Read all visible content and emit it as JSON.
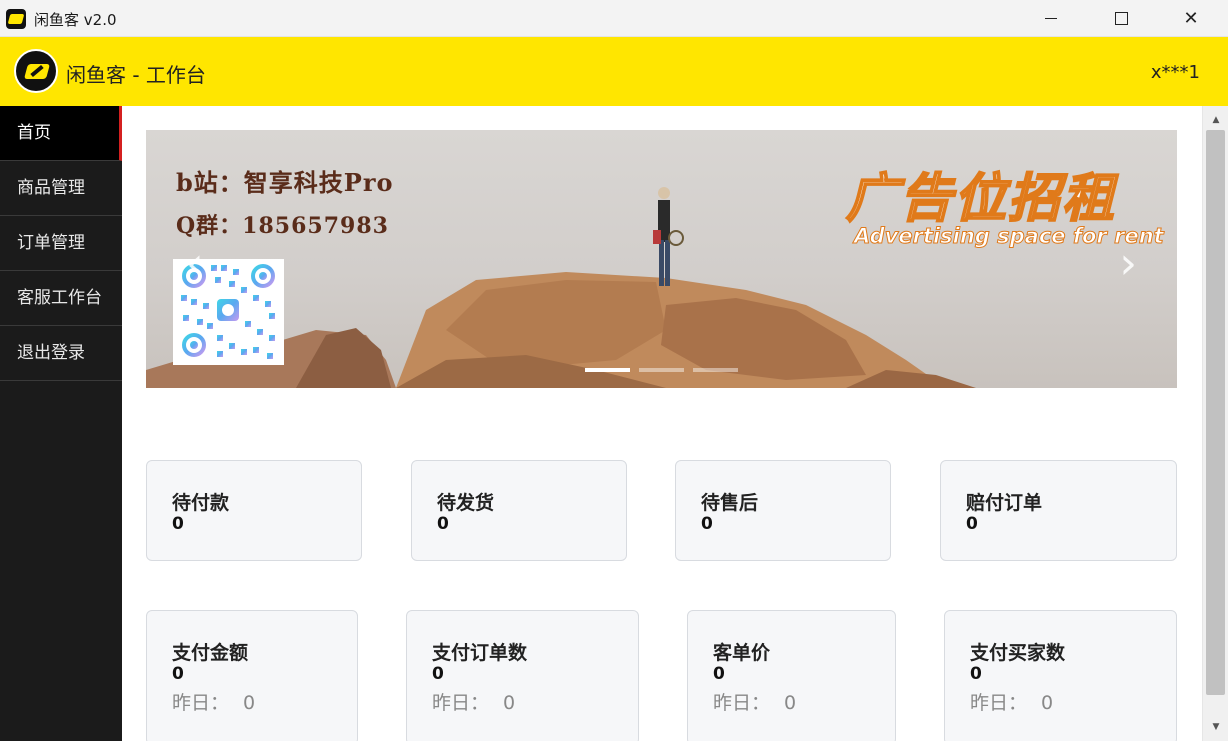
{
  "window": {
    "title": "闲鱼客 v2.0",
    "minimize": "—",
    "close": "✕"
  },
  "header": {
    "title": "闲鱼客 - 工作台",
    "user": "x***1"
  },
  "sidebar": {
    "items": [
      {
        "label": "首页",
        "active": true
      },
      {
        "label": "商品管理"
      },
      {
        "label": "订单管理"
      },
      {
        "label": "客服工作台"
      },
      {
        "label": "退出登录"
      }
    ]
  },
  "banner": {
    "bilibili": "b站：智享科技Pro",
    "qq_group": "Q群：185657983",
    "ad_title": "广告位招租",
    "ad_subtitle": "Advertising space for rent",
    "prev_arrow": "‹",
    "next_arrow": "›",
    "slide_count": 3,
    "active_slide": 1
  },
  "stats_row1": [
    {
      "label": "待付款",
      "value": "0"
    },
    {
      "label": "待发货",
      "value": "0"
    },
    {
      "label": "待售后",
      "value": "0"
    },
    {
      "label": "赔付订单",
      "value": "0"
    }
  ],
  "stats_row2": [
    {
      "label": "支付金额",
      "value": "0",
      "yesterday_label": "昨日：",
      "yesterday_value": "0"
    },
    {
      "label": "支付订单数",
      "value": "0",
      "yesterday_label": "昨日：",
      "yesterday_value": "0"
    },
    {
      "label": "客单价",
      "value": "0",
      "yesterday_label": "昨日：",
      "yesterday_value": "0"
    },
    {
      "label": "支付买家数",
      "value": "0",
      "yesterday_label": "昨日：",
      "yesterday_value": "0"
    }
  ],
  "colors": {
    "header_bg": "#ffe600",
    "sidebar_bg": "#1b1b1b",
    "active_marker": "#d42020",
    "card_bg": "#f6f7f9"
  }
}
